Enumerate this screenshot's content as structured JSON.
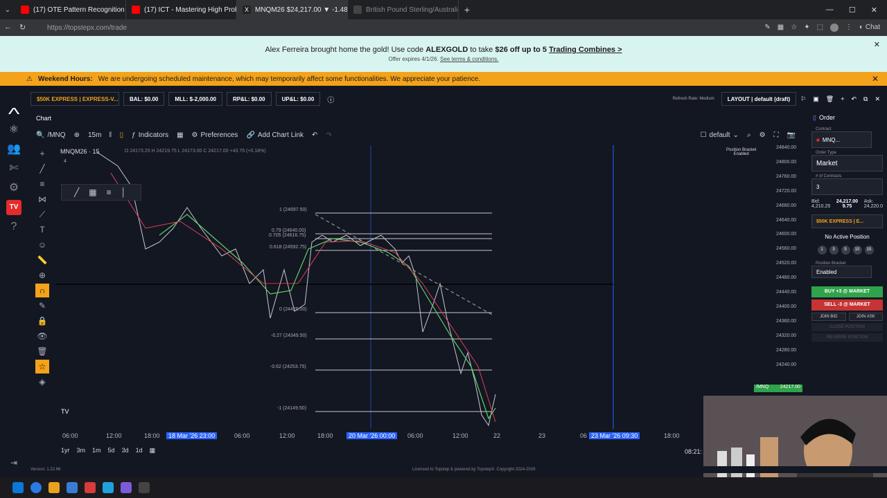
{
  "browser": {
    "tabs": [
      {
        "label": "(17) OTE Pattern Recognition",
        "icon": "youtube-icon",
        "color": "#ff0000"
      },
      {
        "label": "(17) ICT - Mastering High Probabi",
        "icon": "youtube-icon",
        "color": "#ff0000"
      },
      {
        "label": "MNQM26 $24,217.00 ▼ -1.48%",
        "icon": "topstep-x-icon",
        "color": "#ffffff"
      },
      {
        "label": "British Pound Sterling/Australian",
        "icon": "tradingview-icon",
        "color": "#888888"
      }
    ],
    "url": "https://topstepx.com/trade"
  },
  "promo": {
    "text_pre": "Alex Ferreira brought home the gold! Use code ",
    "code": "ALEXGOLD",
    "text_mid": " to take ",
    "discount": "$26 off up to 5",
    "link": "Trading Combines >",
    "subtext": "Offer expires 4/1/26.",
    "terms": "See terms & conditions."
  },
  "maintenance": {
    "title": "Weekend Hours:",
    "message": "We are undergoing scheduled maintenance, which may temporarily affect some functionalities. We appreciate your patience."
  },
  "account": {
    "selector": "$50K EXPRESS | EXPRESS-V...",
    "bal": "BAL: $0.00",
    "mll": "MLL: $-2,000.00",
    "rpl": "RP&L: $0.00",
    "upl": "UP&L: $0.00",
    "refresh": "Refresh Rate: Medium",
    "layout": "LAYOUT | default (draft)"
  },
  "chart": {
    "tab_label": "Chart",
    "symbol": "/MNQ",
    "interval": "15m",
    "indicators": "Indicators",
    "preferences": "Preferences",
    "add_link": "Add Chart Link",
    "template": "default",
    "legend_symbol": "MNQM26 · 15",
    "legend_ohlc": "O 24173.25  H 24219.75  L 24173.00  C 24217.00 +43.75 (+0.18%)",
    "legend_count": "4",
    "position_bracket": "Position Bracket",
    "position_bracket_state": "Enabled",
    "price_labels": [
      "24840.00",
      "24800.00",
      "24760.00",
      "24720.00",
      "24680.00",
      "24640.00",
      "24600.00",
      "24560.00",
      "24520.00",
      "24480.00",
      "24440.00",
      "24400.00",
      "24360.00",
      "24320.00",
      "24280.00",
      "24240.00"
    ],
    "current_price_tag": "24217.00",
    "current_symbol_tag": "/MNQ",
    "fib_levels": [
      "1 (24697.50)",
      "0.79 (24640.00)",
      "0.705 (24616.75)",
      "0.618 (24592.75)",
      "0 (24425.00)",
      "-0.27 (24349.50)",
      "-0.62 (24253.75)",
      "-1 (24149.50)"
    ],
    "time_labels": [
      "06:00",
      "12:00",
      "18:00",
      "18 Mar '26  23:00",
      "06:00",
      "12:00",
      "18:00",
      "20 Mar '26  00:00",
      "06:00",
      "12:00",
      "22",
      "23",
      "06",
      "23 Mar '26  09:30",
      "18:00"
    ],
    "timeframes": [
      "1yr",
      "3m",
      "1m",
      "5d",
      "3d",
      "1d"
    ],
    "clock": "08:21:"
  },
  "order_panel": {
    "header": "Order",
    "contract_label": "Contract",
    "contract": "MNQ...",
    "order_type_label": "Order Type",
    "order_type": "Market",
    "contracts_label": "# of Contracts",
    "contracts": "3",
    "bid_label": "Bid:",
    "bid": "4,210.25",
    "last": "24,217.00",
    "last_size": "9.75",
    "ask_label": "Ask:",
    "ask": "24,220.0",
    "account": "$50K EXPRESS | E...",
    "no_position": "No Active Position",
    "qty_buttons": [
      "1",
      "3",
      "5",
      "10",
      "15"
    ],
    "bracket_label": "Position Bracket",
    "bracket": "Enabled",
    "buy": "BUY +3 @ MARKET",
    "sell": "SELL -3 @ MARKET",
    "join_bid": "JOIN BID",
    "join_ask": "JOIN ASK",
    "close": "CLOSE POSITION",
    "reverse": "REVERSE POSITION"
  },
  "footer": {
    "version": "Version: 1.22.66",
    "license": "Licensed to Topstep & powered by TopstepX. Copyright 2024-2026"
  },
  "colors": {
    "promo_bg": "#d8f4f1",
    "maint_bg": "#f3a21a",
    "buy": "#2fa34a",
    "sell": "#c53434",
    "fib": "#c8c8c8"
  }
}
